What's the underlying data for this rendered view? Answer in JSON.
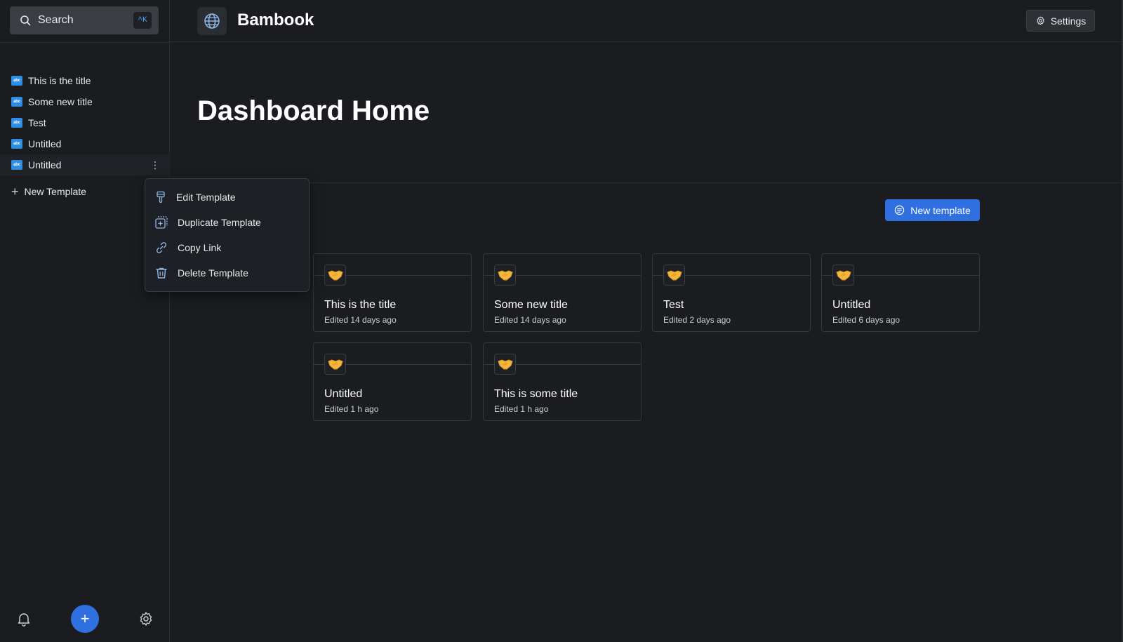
{
  "search": {
    "label": "Search",
    "shortcut": "^K"
  },
  "sidebar": {
    "items": [
      {
        "label": "This is the title"
      },
      {
        "label": "Some new title"
      },
      {
        "label": "Test"
      },
      {
        "label": "Untitled"
      },
      {
        "label": "Untitled"
      }
    ],
    "new_template_label": "New Template",
    "fab_label": "+"
  },
  "header": {
    "brand": "Bambook",
    "settings_label": "Settings"
  },
  "main": {
    "title": "Dashboard Home",
    "new_template_button": "New template",
    "cards": [
      {
        "title": "This is the title",
        "meta": "Edited 14 days ago"
      },
      {
        "title": "Some new title",
        "meta": "Edited 14 days ago"
      },
      {
        "title": "Test",
        "meta": "Edited 2 days ago"
      },
      {
        "title": "Untitled",
        "meta": "Edited 6 days ago"
      },
      {
        "title": "Untitled",
        "meta": "Edited 1 h ago"
      },
      {
        "title": "This is some title",
        "meta": "Edited 1 h ago"
      }
    ]
  },
  "context_menu": {
    "items": [
      {
        "label": "Edit Template",
        "icon": "brush-icon"
      },
      {
        "label": "Duplicate Template",
        "icon": "duplicate-icon"
      },
      {
        "label": "Copy Link",
        "icon": "link-icon"
      },
      {
        "label": "Delete Template",
        "icon": "trash-icon"
      }
    ]
  },
  "colors": {
    "background": "#1a1c20",
    "accent": "#2f6fe0",
    "doc_icon": "#2f8de4",
    "emoji": "#f4b73a"
  }
}
